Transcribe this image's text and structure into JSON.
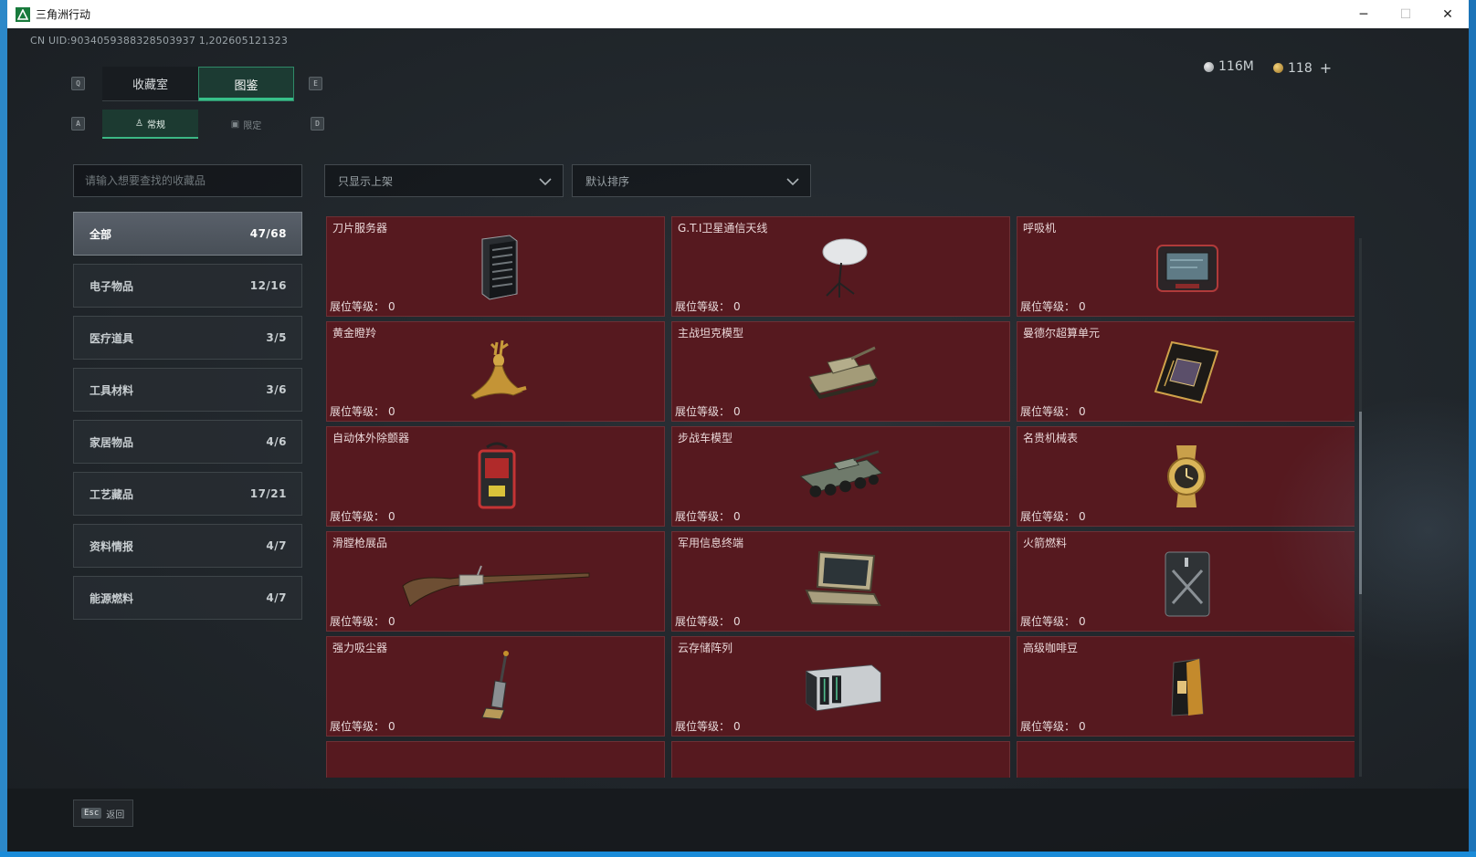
{
  "window": {
    "title": "三角洲行动",
    "controls": {
      "minimize": "─",
      "maximize": "☐",
      "close": "✕"
    }
  },
  "header": {
    "uid": "CN UID:9034059388328503937 1,202605121323",
    "currency": [
      {
        "icon": "silver-coin-icon",
        "value": "116M"
      },
      {
        "icon": "gold-coin-icon",
        "value": "118"
      }
    ],
    "add_label": "+"
  },
  "keys": {
    "tab_prev": "Q",
    "tab_next": "E",
    "sub_prev": "A",
    "sub_next": "D"
  },
  "main_tabs": [
    {
      "label": "收藏室",
      "active": false
    },
    {
      "label": "图鉴",
      "active": true
    }
  ],
  "sub_tabs": [
    {
      "label": "常规",
      "icon": "figure-icon",
      "active": true
    },
    {
      "label": "限定",
      "icon": "image-icon",
      "active": false
    }
  ],
  "search": {
    "placeholder": "请输入想要查找的收藏品",
    "value": ""
  },
  "filters": {
    "filter_label": "只显示上架",
    "sort_label": "默认排序"
  },
  "categories": [
    {
      "label": "全部",
      "count": "47/68",
      "active": true
    },
    {
      "label": "电子物品",
      "count": "12/16",
      "active": false
    },
    {
      "label": "医疗道具",
      "count": "3/5",
      "active": false
    },
    {
      "label": "工具材料",
      "count": "3/6",
      "active": false
    },
    {
      "label": "家居物品",
      "count": "4/6",
      "active": false
    },
    {
      "label": "工艺藏品",
      "count": "17/21",
      "active": false
    },
    {
      "label": "资料情报",
      "count": "4/7",
      "active": false
    },
    {
      "label": "能源燃料",
      "count": "4/7",
      "active": false
    }
  ],
  "level_label": "展位等级：",
  "items": [
    {
      "name": "刀片服务器",
      "level": "0",
      "icon": "server-icon"
    },
    {
      "name": "G.T.I卫星通信天线",
      "level": "0",
      "icon": "satellite-dish-icon"
    },
    {
      "name": "呼吸机",
      "level": "0",
      "icon": "ventilator-icon"
    },
    {
      "name": "黄金瞪羚",
      "level": "0",
      "icon": "golden-gazelle-icon"
    },
    {
      "name": "主战坦克模型",
      "level": "0",
      "icon": "tank-icon"
    },
    {
      "name": "曼德尔超算单元",
      "level": "0",
      "icon": "circuit-board-icon"
    },
    {
      "name": "自动体外除颤器",
      "level": "0",
      "icon": "defibrillator-icon"
    },
    {
      "name": "步战车模型",
      "level": "0",
      "icon": "armored-vehicle-icon"
    },
    {
      "name": "名贵机械表",
      "level": "0",
      "icon": "watch-icon"
    },
    {
      "name": "滑膛枪展品",
      "level": "0",
      "icon": "musket-icon"
    },
    {
      "name": "军用信息终端",
      "level": "0",
      "icon": "terminal-icon"
    },
    {
      "name": "火箭燃料",
      "level": "0",
      "icon": "fuel-canister-icon"
    },
    {
      "name": "强力吸尘器",
      "level": "0",
      "icon": "vacuum-icon"
    },
    {
      "name": "云存储阵列",
      "level": "0",
      "icon": "storage-array-icon"
    },
    {
      "name": "高级咖啡豆",
      "level": "0",
      "icon": "coffee-bag-icon"
    }
  ],
  "footer": {
    "esc_key": "Esc",
    "back_label": "返回"
  }
}
